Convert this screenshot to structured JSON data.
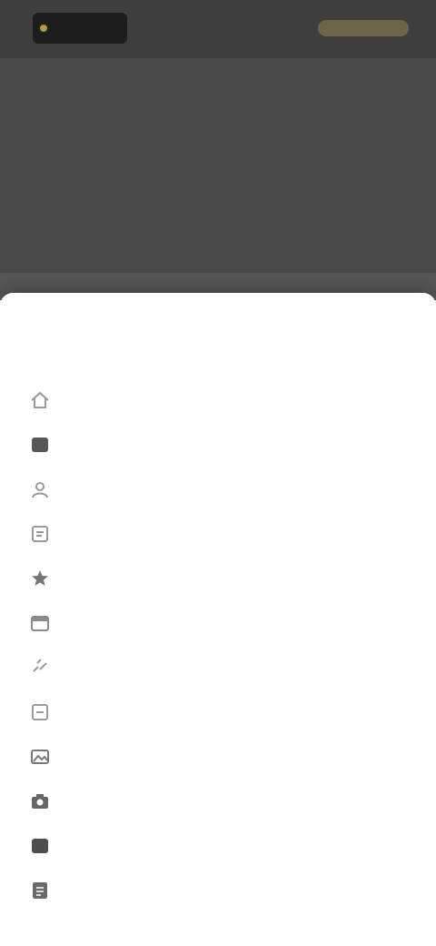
{
  "background": {
    "logo_text": "",
    "nav": [
      "",
      "",
      ""
    ],
    "lines": [
      "",
      "",
      ""
    ]
  },
  "sheet": {
    "title": "",
    "items": [
      {
        "label": "",
        "icon": "home-icon"
      },
      {
        "label": "",
        "icon": "square-filled-icon"
      },
      {
        "label": "",
        "icon": "person-icon"
      },
      {
        "label": "",
        "icon": "document-icon"
      },
      {
        "label": "",
        "icon": "star-icon"
      },
      {
        "label": "",
        "icon": "calendar-icon"
      },
      {
        "label": "",
        "icon": "link-icon"
      },
      {
        "label": "",
        "icon": "document-icon"
      },
      {
        "label": "",
        "icon": "image-icon"
      },
      {
        "label": "",
        "icon": "camera-icon"
      },
      {
        "label": "",
        "icon": "square-filled-icon"
      },
      {
        "label": "",
        "icon": "document-icon"
      }
    ]
  },
  "colors": {
    "overlay": "#4a4a4a",
    "sheet": "#ffffff",
    "accent": "#b89a3a"
  }
}
